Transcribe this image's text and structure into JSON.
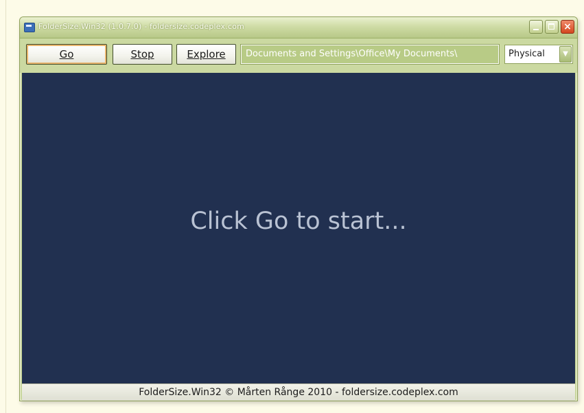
{
  "window": {
    "title": "FolderSize.Win32 (1.0.7.0) - foldersize.codeplex.com"
  },
  "toolbar": {
    "go_label": "Go",
    "stop_label": "Stop",
    "explore_label": "Explore",
    "path_value": "Documents and Settings\\Office\\My Documents\\",
    "mode_selected": "Physical"
  },
  "main": {
    "message": "Click Go to start..."
  },
  "status": {
    "text": "FolderSize.Win32 © Mårten Rånge 2010 - foldersize.codeplex.com"
  },
  "icons": {
    "app": "folder-size-app-icon",
    "minimize": "minimize-icon",
    "maximize": "maximize-icon",
    "close": "close-icon",
    "dropdown": "chevron-down-icon"
  },
  "colors": {
    "panel_background": "#213050",
    "window_chrome": "#c9d79e",
    "message_text": "#b9c2d3",
    "close_button": "#d4471f"
  }
}
